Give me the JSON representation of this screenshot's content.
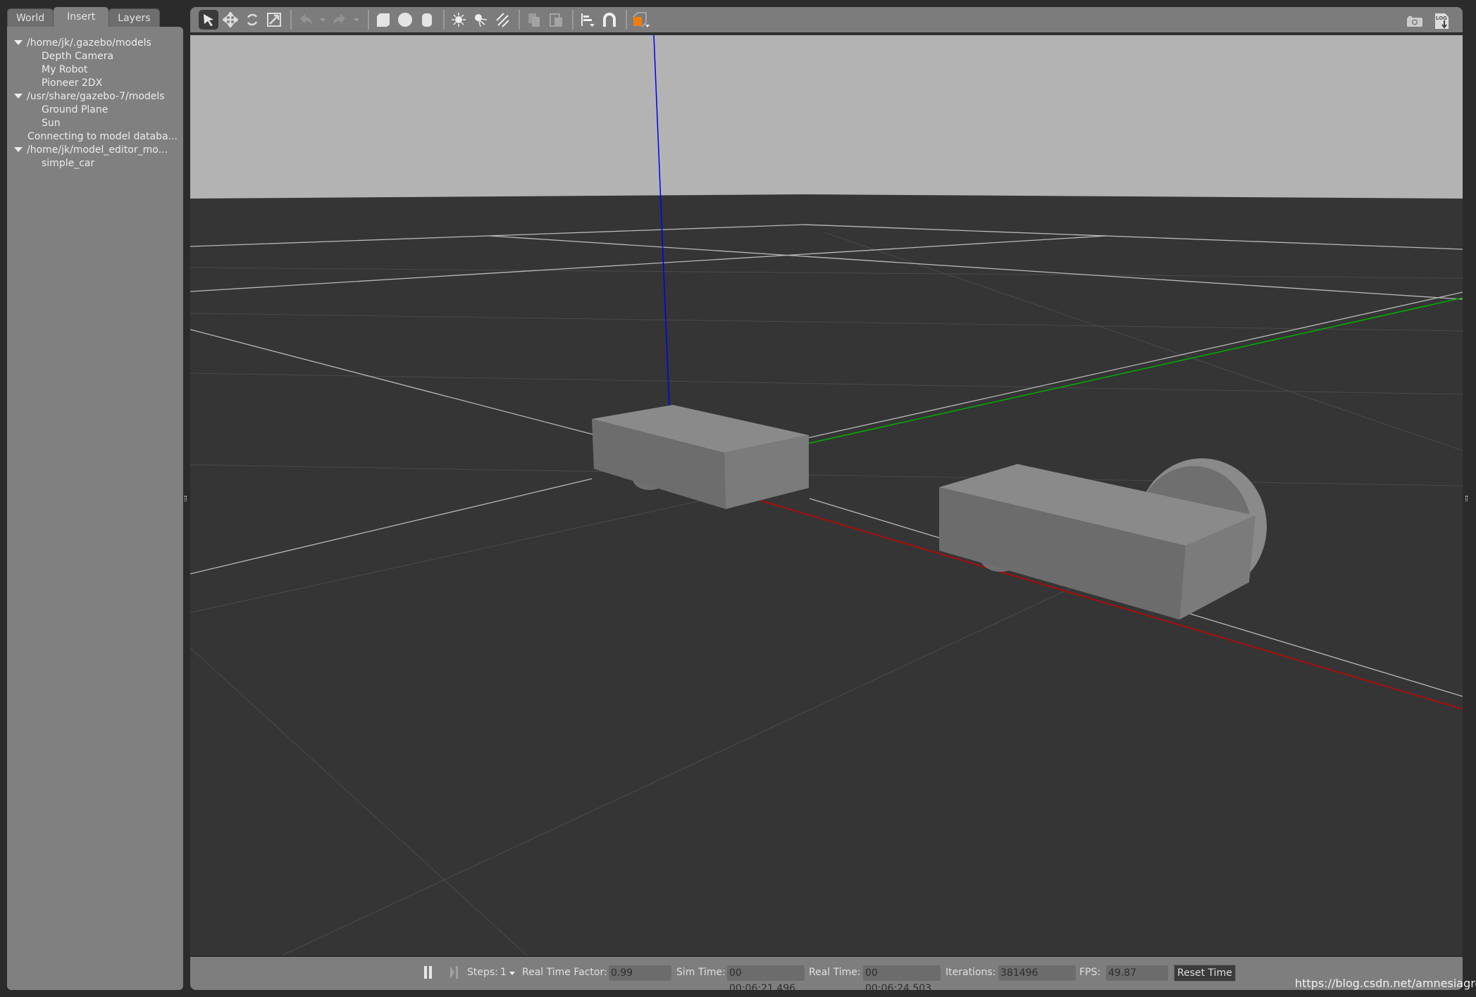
{
  "left_panel": {
    "tabs": [
      {
        "label": "World"
      },
      {
        "label": "Insert",
        "active": true
      },
      {
        "label": "Layers"
      }
    ],
    "tree": [
      {
        "label": "/home/jk/.gazebo/models",
        "children": [
          "Depth Camera",
          "My Robot",
          "Pioneer 2DX"
        ]
      },
      {
        "label": "/usr/share/gazebo-7/models",
        "children": [
          "Ground Plane",
          "Sun"
        ]
      },
      {
        "message": "Connecting to model databa..."
      },
      {
        "label": "/home/jk/model_editor_mo...",
        "children": [
          "simple_car"
        ]
      }
    ]
  },
  "toolbar": {
    "icons": [
      "select-arrow-icon",
      "translate-icon",
      "rotate-icon",
      "scale-icon",
      "undo-icon",
      "redo-icon",
      "box-icon",
      "sphere-icon",
      "cylinder-icon",
      "point-light-icon",
      "spot-light-icon",
      "directional-light-icon",
      "copy-icon",
      "paste-icon",
      "align-icon",
      "snap-magnet-icon",
      "view-angle-icon"
    ],
    "right_icons": [
      "screenshot-camera-icon",
      "log-icon"
    ],
    "log_label": "LOG"
  },
  "bottom_bar": {
    "steps_label": "Steps:",
    "steps_value": "1",
    "rtf_label": "Real Time Factor:",
    "rtf_value": "0.99",
    "sim_time_label": "Sim Time:",
    "sim_time_value": "00 00:06:21.496",
    "real_time_label": "Real Time:",
    "real_time_value": "00 00:06:24.503",
    "iterations_label": "Iterations:",
    "iterations_value": "381496",
    "fps_label": "FPS:",
    "fps_value": "49.87",
    "reset_label": "Reset Time"
  },
  "colors": {
    "x_axis": "#cc0000",
    "y_axis": "#00b000",
    "z_axis": "#0000ee",
    "sky": "#b3b3b3",
    "ground": "#353535",
    "accent_orange": "#f07d10"
  },
  "watermark": "https://blog.csdn.net/amnesiagreen"
}
